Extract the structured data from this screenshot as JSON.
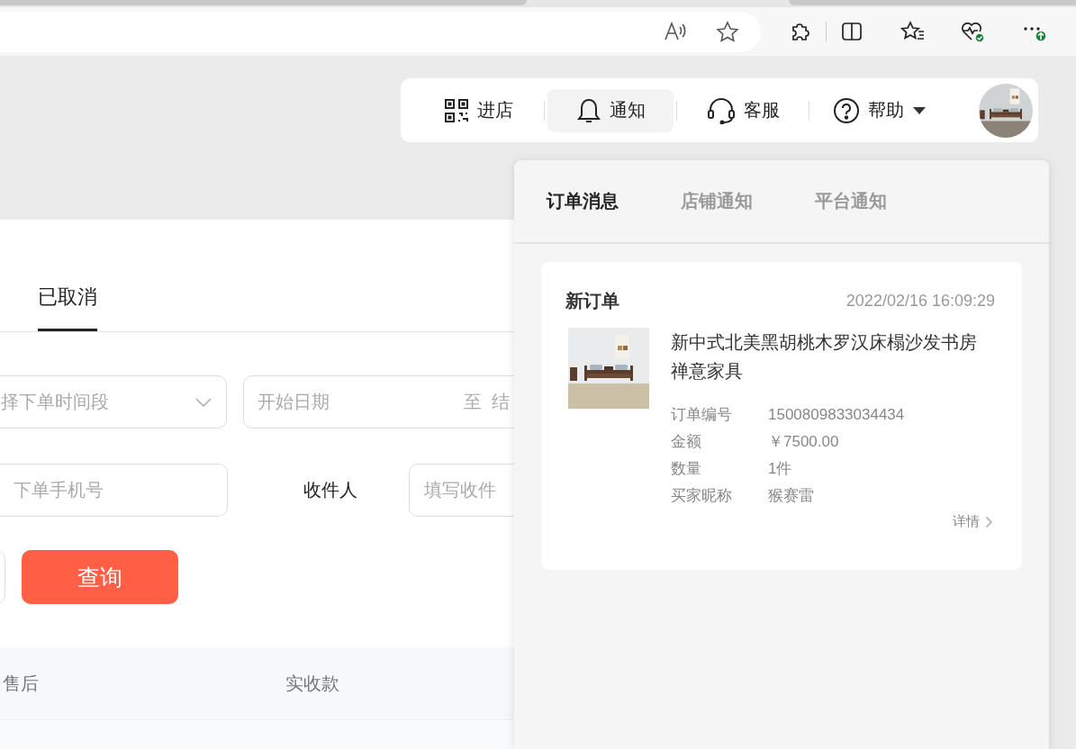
{
  "header_nav": {
    "items": [
      {
        "label": "进店",
        "kind": "qr",
        "selected": false
      },
      {
        "label": "通知",
        "kind": "bell",
        "selected": true
      },
      {
        "label": "客服",
        "kind": "headset",
        "selected": false
      },
      {
        "label": "帮助",
        "kind": "help",
        "selected": false
      }
    ]
  },
  "order_tabs": [
    {
      "label": "已取消",
      "selected": true
    }
  ],
  "filters": {
    "time_range": {
      "placeholder": "择下单时间段"
    },
    "date_range": {
      "start_placeholder": "开始日期",
      "separator": "至",
      "end_placeholder": "结"
    },
    "phone": {
      "placeholder": "下单手机号"
    },
    "recipient": {
      "label": "收件人",
      "placeholder": "填写收件"
    }
  },
  "query_button": "查询",
  "table": {
    "columns": [
      "售后",
      "实收款"
    ]
  },
  "notifications": {
    "tabs": [
      {
        "label": "订单消息",
        "selected": true
      },
      {
        "label": "店铺通知",
        "selected": false
      },
      {
        "label": "平台通知",
        "selected": false
      }
    ],
    "cards": [
      {
        "title": "新订单",
        "time": "2022/02/16 16:09:29",
        "product": "新中式北美黑胡桃木罗汉床榻沙发书房禅意家具",
        "fields": [
          {
            "label": "订单编号",
            "value": "1500809833034434"
          },
          {
            "label": "金额",
            "value": "￥7500.00"
          },
          {
            "label": "数量",
            "value": "1件"
          },
          {
            "label": "买家昵称",
            "value": "猴赛雷"
          }
        ],
        "link": "详情"
      }
    ]
  }
}
